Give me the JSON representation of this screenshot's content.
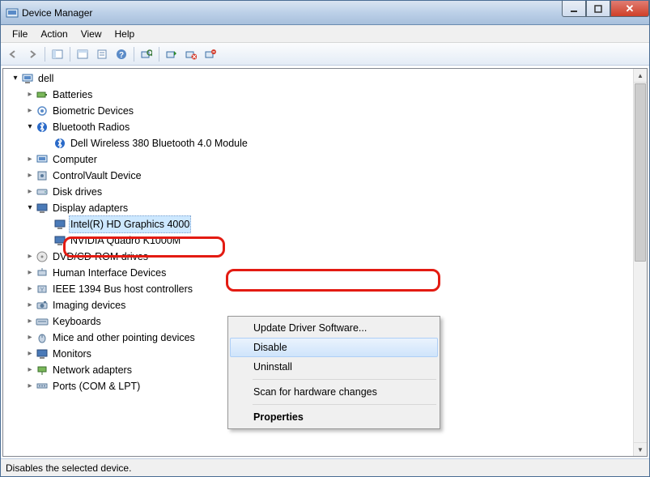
{
  "title": "Device Manager",
  "menus": [
    "File",
    "Action",
    "View",
    "Help"
  ],
  "statusbar": "Disables the selected device.",
  "root": "dell",
  "categories": [
    {
      "label": "Batteries",
      "expanded": false,
      "icon": "battery"
    },
    {
      "label": "Biometric Devices",
      "expanded": false,
      "icon": "biometric"
    },
    {
      "label": "Bluetooth Radios",
      "expanded": true,
      "icon": "bluetooth",
      "children": [
        {
          "label": "Dell Wireless 380 Bluetooth 4.0 Module",
          "icon": "bluetooth"
        }
      ]
    },
    {
      "label": "Computer",
      "expanded": false,
      "icon": "computer"
    },
    {
      "label": "ControlVault Device",
      "expanded": false,
      "icon": "vault"
    },
    {
      "label": "Disk drives",
      "expanded": false,
      "icon": "disk"
    },
    {
      "label": "Display adapters",
      "expanded": true,
      "icon": "monitor",
      "children": [
        {
          "label": "Intel(R) HD Graphics 4000",
          "icon": "monitor",
          "selected": true
        },
        {
          "label": "NVIDIA Quadro K1000M",
          "icon": "monitor"
        }
      ]
    },
    {
      "label": "DVD/CD-ROM drives",
      "expanded": false,
      "icon": "cdrom"
    },
    {
      "label": "Human Interface Devices",
      "expanded": false,
      "icon": "hid"
    },
    {
      "label": "IEEE 1394 Bus host controllers",
      "icon": "ieee",
      "expanded": false
    },
    {
      "label": "Imaging devices",
      "expanded": false,
      "icon": "imaging"
    },
    {
      "label": "Keyboards",
      "expanded": false,
      "icon": "keyboard"
    },
    {
      "label": "Mice and other pointing devices",
      "expanded": false,
      "icon": "mouse"
    },
    {
      "label": "Monitors",
      "expanded": false,
      "icon": "monitor"
    },
    {
      "label": "Network adapters",
      "expanded": false,
      "icon": "network"
    },
    {
      "label": "Ports (COM & LPT)",
      "expanded": false,
      "icon": "port"
    }
  ],
  "context_menu": [
    {
      "label": "Update Driver Software...",
      "kind": "item"
    },
    {
      "label": "Disable",
      "kind": "item",
      "hover": true
    },
    {
      "label": "Uninstall",
      "kind": "item"
    },
    {
      "kind": "sep"
    },
    {
      "label": "Scan for hardware changes",
      "kind": "item"
    },
    {
      "kind": "sep"
    },
    {
      "label": "Properties",
      "kind": "item",
      "bold": true
    }
  ],
  "toolbar": [
    {
      "name": "back",
      "type": "arrow-left"
    },
    {
      "name": "forward",
      "type": "arrow-right"
    },
    {
      "name": "sep"
    },
    {
      "name": "show-hide-tree",
      "type": "panel"
    },
    {
      "name": "sep"
    },
    {
      "name": "help",
      "type": "help"
    },
    {
      "name": "properties",
      "type": "props"
    },
    {
      "name": "help2",
      "type": "qmark"
    },
    {
      "name": "sep"
    },
    {
      "name": "scan",
      "type": "scan"
    },
    {
      "name": "sep"
    },
    {
      "name": "update-driver",
      "type": "updrv"
    },
    {
      "name": "disable",
      "type": "disable"
    },
    {
      "name": "uninstall",
      "type": "uninstall"
    }
  ],
  "colors": {
    "highlight_red": "#e31b12",
    "selection": "#cde8ff",
    "menu_hover": "#cfe4fb"
  }
}
